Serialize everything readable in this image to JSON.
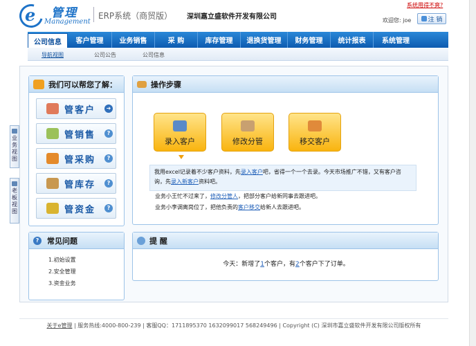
{
  "brand": {
    "logo_cn": "管理",
    "logo_en": "Management",
    "system_title": "ERP系统（商贸版）",
    "company": "深圳嘉立盛软件开发有限公司"
  },
  "topbar": {
    "link": "系统用得不爽?",
    "welcome": "欢迎您: joe",
    "logout": "注 销"
  },
  "nav": {
    "tabs": [
      {
        "label": "公司信息",
        "active": true
      },
      {
        "label": "客户管理"
      },
      {
        "label": "业务销售"
      },
      {
        "label": "采 购"
      },
      {
        "label": "库存管理"
      },
      {
        "label": "退换货管理"
      },
      {
        "label": "财务管理"
      },
      {
        "label": "统计报表"
      },
      {
        "label": "系统管理"
      }
    ]
  },
  "subnav": {
    "items": [
      "导航视图",
      "公司公告",
      "公司信息"
    ]
  },
  "side_tabs": [
    "业务视图",
    "老板视图"
  ],
  "help_panel": {
    "title": "我们可以帮您了解：",
    "buttons": [
      "管客户",
      "管销售",
      "管采购",
      "管库存",
      "管资金"
    ]
  },
  "faq": {
    "title": "常见问题",
    "items": [
      "1.初始设置",
      "2.安全管理",
      "3.资金业务"
    ]
  },
  "steps": {
    "title": "操作步骤",
    "buttons": [
      "录入客户",
      "修改分管",
      "移交客户"
    ],
    "tip_pre1": "我用excel记录着不少客户资料，先",
    "tip_link1": "录入客户",
    "tip_mid1": "吧，省得一个一个去录。今天市场推广不错，又有客户咨询，先",
    "tip_link2": "录入新客户",
    "tip_post2": "资料吧。",
    "line2_pre": "业务小王忙不过来了，",
    "line2_link": "修改分管人",
    "line2_post": "，把部分客户给新同事去跟进吧。",
    "line3_pre": "业务小李调离岗位了，把他负责的",
    "line3_link": "客户移交",
    "line3_post": "给新人去跟进吧。"
  },
  "remind": {
    "title": "提 醒",
    "pre": "今天：新增了",
    "n1": "1",
    "mid": "个客户，有",
    "n2": "2",
    "post": "个客户下了订单。"
  },
  "footer": {
    "about": "关于e管理",
    "text": " | 服务热线:4000-800-239 | 客服QQ：1711895370  1632099017  568249496 | Copyright (C) 深圳市嘉立盛软件开发有限公司版权所有"
  },
  "colors": {
    "nav": "#0d5bb0",
    "accent": "#1b5aa6",
    "step_button": "#f9b40f"
  }
}
